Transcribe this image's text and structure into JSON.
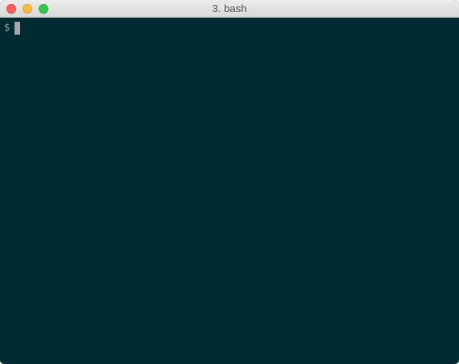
{
  "window": {
    "title": "3. bash",
    "controls": [
      "close",
      "minimize",
      "zoom"
    ]
  },
  "terminal": {
    "prompt": "$",
    "input": "",
    "colors": {
      "background": "#002b33",
      "foreground": "#93a1a1",
      "cursor": "#a3a9ab"
    }
  }
}
